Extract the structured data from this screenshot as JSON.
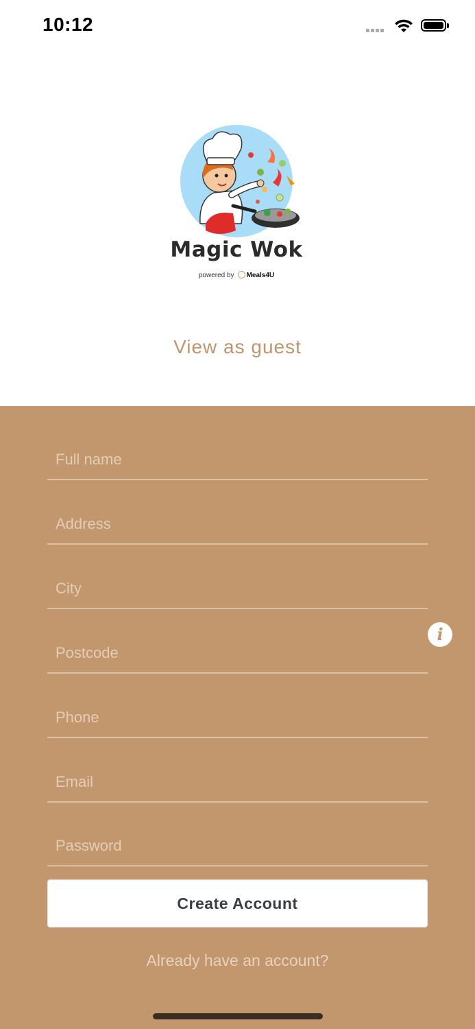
{
  "status": {
    "time": "10:12"
  },
  "brand": {
    "name": "Magic Wok",
    "powered_by": "powered by",
    "partner": "Meals4U"
  },
  "guest_link": "View as guest",
  "form": {
    "fields": [
      {
        "placeholder": "Full name"
      },
      {
        "placeholder": "Address"
      },
      {
        "placeholder": "City"
      },
      {
        "placeholder": "Postcode"
      },
      {
        "placeholder": "Phone"
      },
      {
        "placeholder": "Email"
      },
      {
        "placeholder": "Password"
      }
    ],
    "submit_label": "Create Account",
    "login_link": "Already have an account?"
  },
  "colors": {
    "accent": "#c3976d",
    "guest_link": "#c0956b",
    "logo_circle": "#a9dcf6"
  },
  "icons": [
    "wifi-icon",
    "battery-icon",
    "signal-icon",
    "info-icon"
  ]
}
